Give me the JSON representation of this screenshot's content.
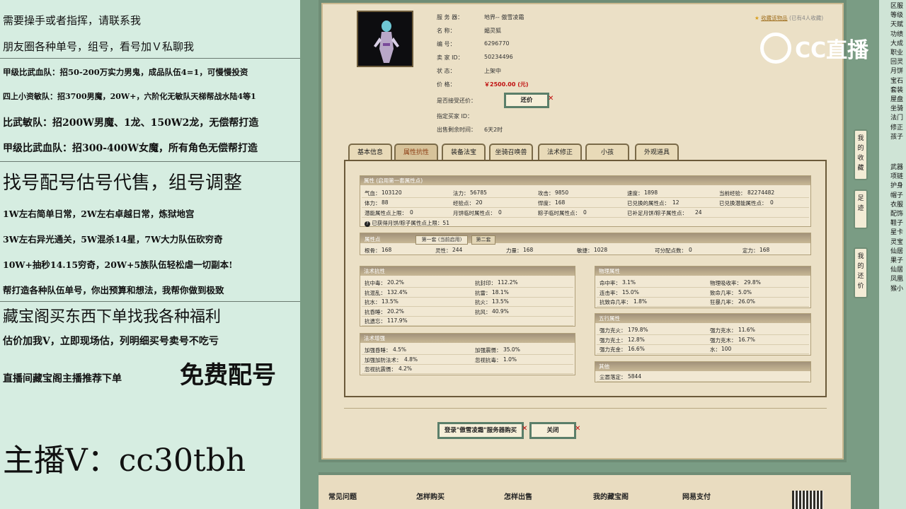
{
  "overlay": {
    "lines": [
      "需要操手或者指挥，请联系我",
      "朋友圈各种单号，组号，看号加Ｖ私聊我",
      "甲级比武血队：招50-200万实力男鬼，成品队伍4=1，可慢慢投资",
      "四上小资敏队：招3700男魔，20W+，六阶化无敏队天梯帮战水陆4等1",
      "比武敏队：招200W男魔、1龙、150W2龙，无偿帮打造",
      "甲级比武血队：招300-400W女魔，所有角色无偿帮打造",
      "找号配号估号代售，组号调整",
      "1W左右简单日常，2W左右卓越日常，炼狱地宫",
      "3W左右异光通关，5W混杀14星，7W大力队伍砍穷奇",
      "10W+抽秒14.15穷奇，20W+5族队伍轻松虐一切副本!",
      "帮打造各种队伍单号，你出预算和想法，我帮你做到极致",
      "藏宝阁买东西下单找我各种福利",
      "估价加我V，立即现场估，列明细买号卖号不吃亏",
      "直播间藏宝阁主播推荐下单",
      "免费配号",
      "主播V：cc30tbh"
    ],
    "logo": "CC直播"
  },
  "item": {
    "fav": "收藏该物品",
    "fav_count": "(已有4人收藏)",
    "fields": [
      {
        "label": "服 务 器：",
        "value": "地界-- 傲雪凌霜"
      },
      {
        "label": "名       称：",
        "value": "媚灵狐"
      },
      {
        "label": "编       号：",
        "value": "6296770"
      },
      {
        "label": "卖  家   ID：",
        "value": "50234496"
      },
      {
        "label": "状       态：",
        "value": "上架中"
      },
      {
        "label": "价       格：",
        "value": "￥2500.00 (元)"
      }
    ],
    "bargain_label": "是否接受还价：",
    "bargain_btn": "还价",
    "buyer_label": "指定买家 ID：",
    "buyer_value": "",
    "time_label": "出售剩余时间：",
    "time_value": "6天2时"
  },
  "tabs": [
    "基本信息",
    "属性抗性",
    "装备法宝",
    "坐骑召唤兽",
    "法术修正",
    "小孩",
    "外观道具"
  ],
  "attr": {
    "title": "属性 (启用第一套属性点)",
    "row1": [
      [
        "气血：",
        "103120"
      ],
      [
        "法力：",
        "56785"
      ],
      [
        "攻击：",
        "9850"
      ],
      [
        "速度：",
        "1898"
      ],
      [
        "当前经验：",
        "82274482"
      ]
    ],
    "row2": [
      [
        "体力：",
        "88"
      ],
      [
        "经验点：",
        "20"
      ],
      [
        "悍度：",
        "168"
      ],
      [
        "已兑换的属性点：",
        "12"
      ],
      [
        "已兑换潜能属性点：",
        "0"
      ]
    ],
    "row3": [
      [
        "潜能属性点上限：",
        "0"
      ],
      [
        "月饼临时属性点：",
        "0"
      ],
      [
        "粽子临时属性点：",
        "0"
      ],
      [
        "已补足月饼/粽子属性点：",
        "24"
      ]
    ],
    "row4": "已获得月饼/粽子属性点上限：51"
  },
  "points": {
    "title": "属性点",
    "tab1": "第一套 (当前启用)",
    "tab2": "第二套",
    "vals": [
      [
        "根骨：",
        "168"
      ],
      [
        "灵性：",
        "244"
      ],
      [
        "力量：",
        "168"
      ],
      [
        "敏捷：",
        "1028"
      ],
      [
        "可分配点数：",
        "0"
      ],
      [
        "定力：",
        "168"
      ]
    ]
  },
  "fakang": {
    "title": "法术抗性",
    "rows": [
      [
        [
          "抗中毒：",
          "20.2%"
        ],
        [
          "抗封印：",
          "112.2%"
        ]
      ],
      [
        [
          "抗混乱：",
          "132.4%"
        ],
        [
          "抗雷：",
          "18.1%"
        ]
      ],
      [
        [
          "抗水：",
          "13.5%"
        ],
        [
          "抗火：",
          "13.5%"
        ]
      ],
      [
        [
          "抗昏睡：",
          "20.2%"
        ],
        [
          "抗风：",
          "40.9%"
        ]
      ],
      [
        [
          "抗遗忘：",
          "117.9%"
        ]
      ]
    ]
  },
  "fazeng": {
    "title": "法术增强",
    "rows": [
      [
        [
          "加强昏睡：",
          "4.5%"
        ],
        [
          "加强震慑：",
          "35.0%"
        ]
      ],
      [
        [
          "加强加防法术：",
          "4.8%"
        ],
        [
          "忽视抗毒：",
          "1.0%"
        ]
      ],
      [
        [
          "忽视抗震慑：",
          "4.2%"
        ]
      ]
    ]
  },
  "wuli": {
    "title": "物理属性",
    "rows": [
      [
        [
          "命中率：",
          "3.1%"
        ],
        [
          "物理吸收率：",
          "29.8%"
        ]
      ],
      [
        [
          "连击率：",
          "15.0%"
        ],
        [
          "致命几率：",
          "5.0%"
        ]
      ],
      [
        [
          "抗致命几率：",
          "1.8%"
        ],
        [
          "狂暴几率：",
          "26.0%"
        ]
      ]
    ]
  },
  "wuxing": {
    "title": "五行属性",
    "rows": [
      [
        [
          "强力克火：",
          "179.8%"
        ],
        [
          "强力克水：",
          "11.6%"
        ]
      ],
      [
        [
          "强力克土：",
          "12.8%"
        ],
        [
          "强力克木：",
          "16.7%"
        ]
      ],
      [
        [
          "强力克金：",
          "16.6%"
        ],
        [
          "水：",
          "100"
        ]
      ]
    ]
  },
  "other": {
    "title": "其他",
    "rows": [
      [
        [
          "尘嚣落定：",
          "5844"
        ]
      ]
    ]
  },
  "actions": {
    "login": "登录\"傲雪凌霜\"服务器购买",
    "close": "关闭"
  },
  "footer": [
    "常见问题",
    "怎样购买",
    "怎样出售",
    "我的藏宝阁",
    "网易支付"
  ],
  "sidebar_btns": [
    "我的收藏",
    "足迹",
    "我的还价"
  ],
  "right_strip": [
    "区服",
    "等级",
    "天赋",
    "功绩",
    "大成",
    "职业",
    "回灵",
    "月饼",
    "宝石",
    "套装",
    "屋盘",
    "坐骑",
    "法门",
    "修正",
    "孩子",
    "武器",
    "项链",
    "护身",
    "帽子",
    "衣服",
    "配饰",
    "鞋子",
    "星卡",
    "灵宝",
    "仙居",
    "果子",
    "仙居",
    "凤凰",
    "猴小"
  ]
}
